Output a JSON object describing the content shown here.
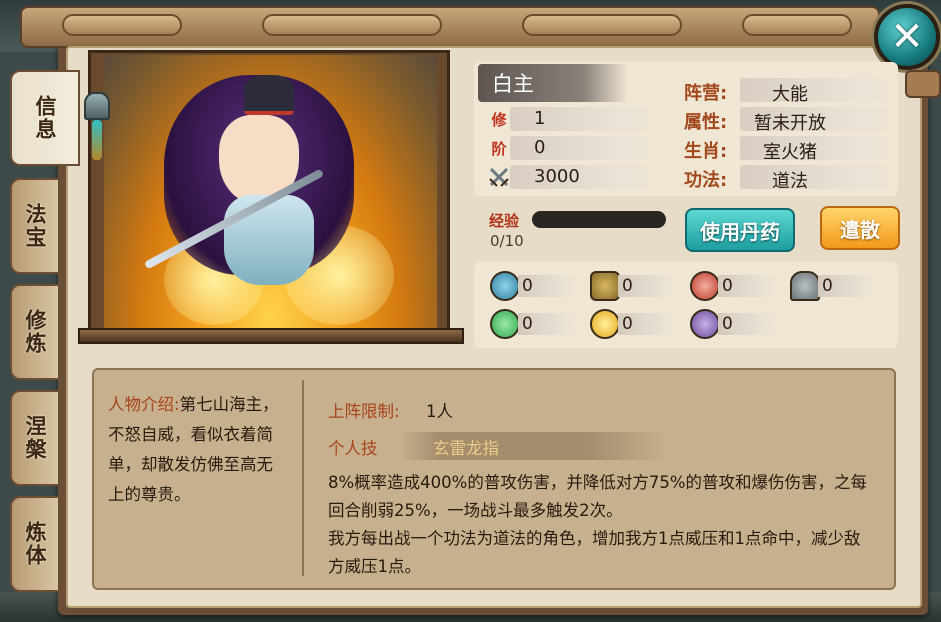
{
  "close_button": {
    "label": "✕"
  },
  "tabs": [
    {
      "label": "信息"
    },
    {
      "label": "法宝"
    },
    {
      "label": "修炼"
    },
    {
      "label": "涅槃"
    },
    {
      "label": "炼体"
    }
  ],
  "hero": {
    "name": "白主",
    "stats": [
      {
        "icon": "修",
        "value": "1"
      },
      {
        "icon": "阶",
        "value": "0"
      },
      {
        "icon": "swords-icon",
        "value": "3000"
      }
    ],
    "attributes": [
      {
        "label": "阵营:",
        "value": "大能"
      },
      {
        "label": "属性:",
        "value": "暂未开放"
      },
      {
        "label": "生肖:",
        "value": "室火猪"
      },
      {
        "label": "功法:",
        "value": "道法"
      }
    ],
    "exp": {
      "label": "经验",
      "value": "0/10",
      "progress": 0
    }
  },
  "buttons": {
    "use_pill": "使用丹药",
    "dismiss": "遣散"
  },
  "items": [
    {
      "icon": "dragon-icon",
      "count": "0",
      "color": "#2f7fa0"
    },
    {
      "icon": "shield-icon",
      "count": "0",
      "color": "#8a6a2a"
    },
    {
      "icon": "fist-icon",
      "count": "0",
      "color": "#c0392b"
    },
    {
      "icon": "helmet-icon",
      "count": "0",
      "color": "#6d7478"
    },
    {
      "icon": "green-orb-icon",
      "count": "0",
      "color": "#2fa84a"
    },
    {
      "icon": "gold-bell-icon",
      "count": "0",
      "color": "#e8a61c"
    },
    {
      "icon": "portrait-icon",
      "count": "0",
      "color": "#6a4a9a"
    }
  ],
  "intro": {
    "label": "人物介绍:",
    "text": "第七山海主，不怒自威，看似衣着简单，却散发仿佛至高无上的尊贵。"
  },
  "limit": {
    "label": "上阵限制:",
    "value": "1人"
  },
  "skill": {
    "label": "个人技",
    "name": "玄雷龙指",
    "description": "8%概率造成400%的普攻伤害，并降低对方75%的普攻和爆伤伤害，之每回合削弱25%，一场战斗最多触发2次。\n我方每出战一个功法为道法的角色，增加我方1点威压和1点命中，减少敌方威压1点。"
  }
}
